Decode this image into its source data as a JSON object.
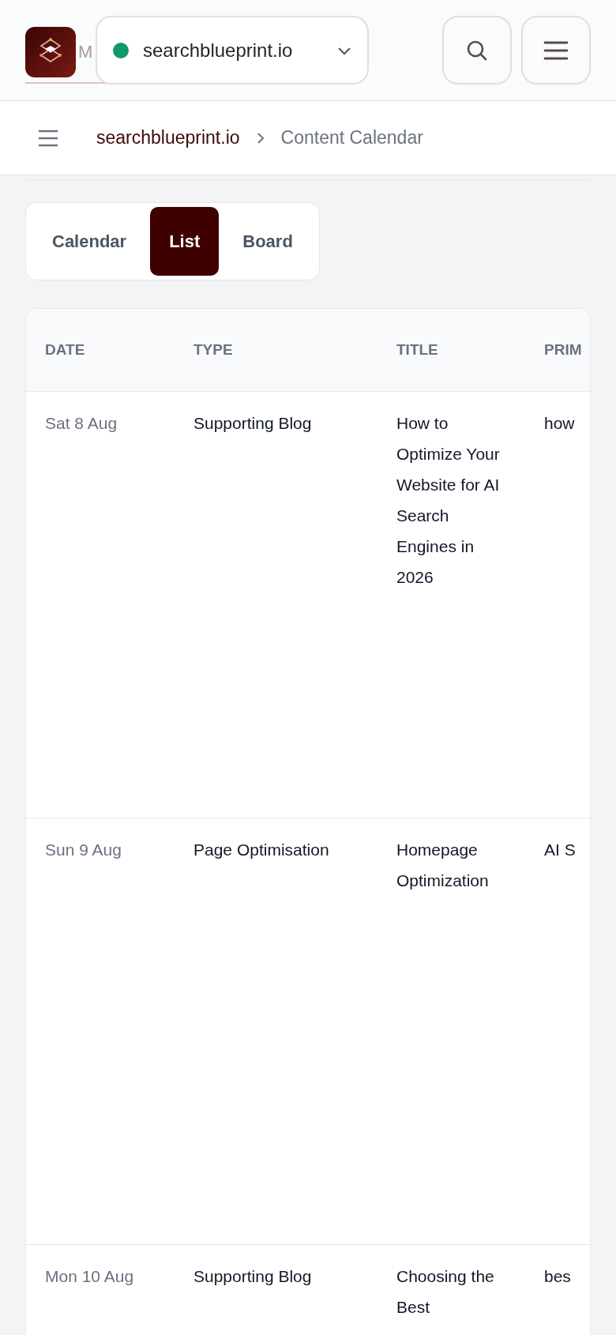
{
  "header": {
    "brand_text": "M",
    "site_selector": {
      "label": "searchblueprint.io"
    }
  },
  "breadcrumb": [
    {
      "label": "searchblueprint.io",
      "kind": "link"
    },
    {
      "label": "Content Calendar",
      "kind": "current"
    }
  ],
  "view_tabs": [
    {
      "label": "Calendar",
      "selected": false
    },
    {
      "label": "List",
      "selected": true
    },
    {
      "label": "Board",
      "selected": false
    }
  ],
  "table": {
    "columns": [
      "DATE",
      "TYPE",
      "TITLE",
      "PRIM"
    ],
    "rows": [
      {
        "date": "Sat 8 Aug",
        "type": "Supporting Blog",
        "title": "How to Optimize Your Website for AI Search Engines in 2026",
        "column_4": "how"
      },
      {
        "date": "Sun 9 Aug",
        "type": "Page Optimisation",
        "title": "Homepage Optimization",
        "column_4": "AI S"
      },
      {
        "date": "Mon 10 Aug",
        "type": "Supporting Blog",
        "title": "Choosing the Best",
        "column_4": "bes"
      }
    ]
  }
}
